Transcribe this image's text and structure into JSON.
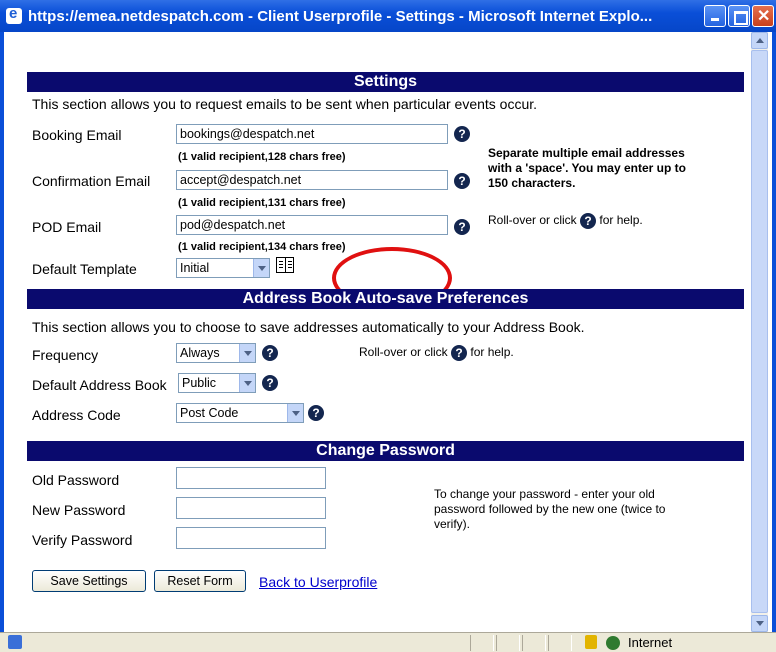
{
  "window": {
    "title": "https://emea.netdespatch.com - Client Userprofile - Settings - Microsoft Internet Explo..."
  },
  "settings": {
    "header": "Settings",
    "intro": "This section allows you to request emails to be sent when particular events occur.",
    "booking_label": "Booking Email",
    "booking_value": "bookings@despatch.net",
    "booking_info": "(1 valid recipient,128 chars free)",
    "confirmation_label": "Confirmation Email",
    "confirmation_value": "accept@despatch.net",
    "confirmation_info": "(1 valid recipient,131 chars free)",
    "pod_label": "POD Email",
    "pod_value": "pod@despatch.net",
    "pod_info": "(1 valid recipient,134 chars free)",
    "template_label": "Default Template",
    "template_value": "Initial",
    "note_separate": "Separate multiple email addresses with a 'space'. You may enter up to 150 characters.",
    "rollover_before": "Roll-over or click",
    "rollover_after": "for help."
  },
  "addressbook": {
    "header": "Address Book Auto-save Preferences",
    "intro": "This section allows you to choose to save addresses automatically to your Address Book.",
    "frequency_label": "Frequency",
    "frequency_value": "Always",
    "default_book_label": "Default Address Book",
    "default_book_value": "Public",
    "address_code_label": "Address Code",
    "address_code_value": "Post Code",
    "rollover_before": "Roll-over or click",
    "rollover_after": "for help."
  },
  "password": {
    "header": "Change Password",
    "old_label": "Old Password",
    "new_label": "New Password",
    "verify_label": "Verify Password",
    "note": "To change your password - enter your old password followed by the new one (twice to verify)."
  },
  "actions": {
    "save_label": "Save Settings",
    "reset_label": "Reset Form",
    "back_label": "Back to Userprofile"
  },
  "statusbar": {
    "zone": "Internet"
  },
  "icons": {
    "help_glyph": "?"
  }
}
